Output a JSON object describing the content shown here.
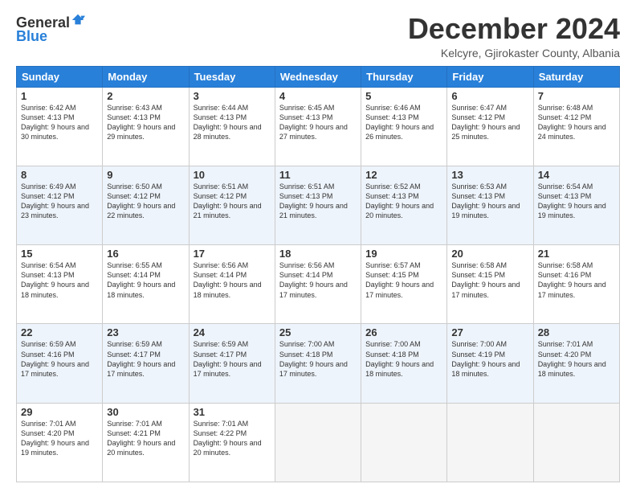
{
  "header": {
    "logo_general": "General",
    "logo_blue": "Blue",
    "month_title": "December 2024",
    "location": "Kelcyre, Gjirokaster County, Albania"
  },
  "weekdays": [
    "Sunday",
    "Monday",
    "Tuesday",
    "Wednesday",
    "Thursday",
    "Friday",
    "Saturday"
  ],
  "weeks": [
    [
      {
        "day": "1",
        "sunrise": "6:42 AM",
        "sunset": "4:13 PM",
        "daylight": "9 hours and 30 minutes."
      },
      {
        "day": "2",
        "sunrise": "6:43 AM",
        "sunset": "4:13 PM",
        "daylight": "9 hours and 29 minutes."
      },
      {
        "day": "3",
        "sunrise": "6:44 AM",
        "sunset": "4:13 PM",
        "daylight": "9 hours and 28 minutes."
      },
      {
        "day": "4",
        "sunrise": "6:45 AM",
        "sunset": "4:13 PM",
        "daylight": "9 hours and 27 minutes."
      },
      {
        "day": "5",
        "sunrise": "6:46 AM",
        "sunset": "4:13 PM",
        "daylight": "9 hours and 26 minutes."
      },
      {
        "day": "6",
        "sunrise": "6:47 AM",
        "sunset": "4:12 PM",
        "daylight": "9 hours and 25 minutes."
      },
      {
        "day": "7",
        "sunrise": "6:48 AM",
        "sunset": "4:12 PM",
        "daylight": "9 hours and 24 minutes."
      }
    ],
    [
      {
        "day": "8",
        "sunrise": "6:49 AM",
        "sunset": "4:12 PM",
        "daylight": "9 hours and 23 minutes."
      },
      {
        "day": "9",
        "sunrise": "6:50 AM",
        "sunset": "4:12 PM",
        "daylight": "9 hours and 22 minutes."
      },
      {
        "day": "10",
        "sunrise": "6:51 AM",
        "sunset": "4:12 PM",
        "daylight": "9 hours and 21 minutes."
      },
      {
        "day": "11",
        "sunrise": "6:51 AM",
        "sunset": "4:13 PM",
        "daylight": "9 hours and 21 minutes."
      },
      {
        "day": "12",
        "sunrise": "6:52 AM",
        "sunset": "4:13 PM",
        "daylight": "9 hours and 20 minutes."
      },
      {
        "day": "13",
        "sunrise": "6:53 AM",
        "sunset": "4:13 PM",
        "daylight": "9 hours and 19 minutes."
      },
      {
        "day": "14",
        "sunrise": "6:54 AM",
        "sunset": "4:13 PM",
        "daylight": "9 hours and 19 minutes."
      }
    ],
    [
      {
        "day": "15",
        "sunrise": "6:54 AM",
        "sunset": "4:13 PM",
        "daylight": "9 hours and 18 minutes."
      },
      {
        "day": "16",
        "sunrise": "6:55 AM",
        "sunset": "4:14 PM",
        "daylight": "9 hours and 18 minutes."
      },
      {
        "day": "17",
        "sunrise": "6:56 AM",
        "sunset": "4:14 PM",
        "daylight": "9 hours and 18 minutes."
      },
      {
        "day": "18",
        "sunrise": "6:56 AM",
        "sunset": "4:14 PM",
        "daylight": "9 hours and 17 minutes."
      },
      {
        "day": "19",
        "sunrise": "6:57 AM",
        "sunset": "4:15 PM",
        "daylight": "9 hours and 17 minutes."
      },
      {
        "day": "20",
        "sunrise": "6:58 AM",
        "sunset": "4:15 PM",
        "daylight": "9 hours and 17 minutes."
      },
      {
        "day": "21",
        "sunrise": "6:58 AM",
        "sunset": "4:16 PM",
        "daylight": "9 hours and 17 minutes."
      }
    ],
    [
      {
        "day": "22",
        "sunrise": "6:59 AM",
        "sunset": "4:16 PM",
        "daylight": "9 hours and 17 minutes."
      },
      {
        "day": "23",
        "sunrise": "6:59 AM",
        "sunset": "4:17 PM",
        "daylight": "9 hours and 17 minutes."
      },
      {
        "day": "24",
        "sunrise": "6:59 AM",
        "sunset": "4:17 PM",
        "daylight": "9 hours and 17 minutes."
      },
      {
        "day": "25",
        "sunrise": "7:00 AM",
        "sunset": "4:18 PM",
        "daylight": "9 hours and 17 minutes."
      },
      {
        "day": "26",
        "sunrise": "7:00 AM",
        "sunset": "4:18 PM",
        "daylight": "9 hours and 18 minutes."
      },
      {
        "day": "27",
        "sunrise": "7:00 AM",
        "sunset": "4:19 PM",
        "daylight": "9 hours and 18 minutes."
      },
      {
        "day": "28",
        "sunrise": "7:01 AM",
        "sunset": "4:20 PM",
        "daylight": "9 hours and 18 minutes."
      }
    ],
    [
      {
        "day": "29",
        "sunrise": "7:01 AM",
        "sunset": "4:20 PM",
        "daylight": "9 hours and 19 minutes."
      },
      {
        "day": "30",
        "sunrise": "7:01 AM",
        "sunset": "4:21 PM",
        "daylight": "9 hours and 20 minutes."
      },
      {
        "day": "31",
        "sunrise": "7:01 AM",
        "sunset": "4:22 PM",
        "daylight": "9 hours and 20 minutes."
      },
      null,
      null,
      null,
      null
    ]
  ]
}
